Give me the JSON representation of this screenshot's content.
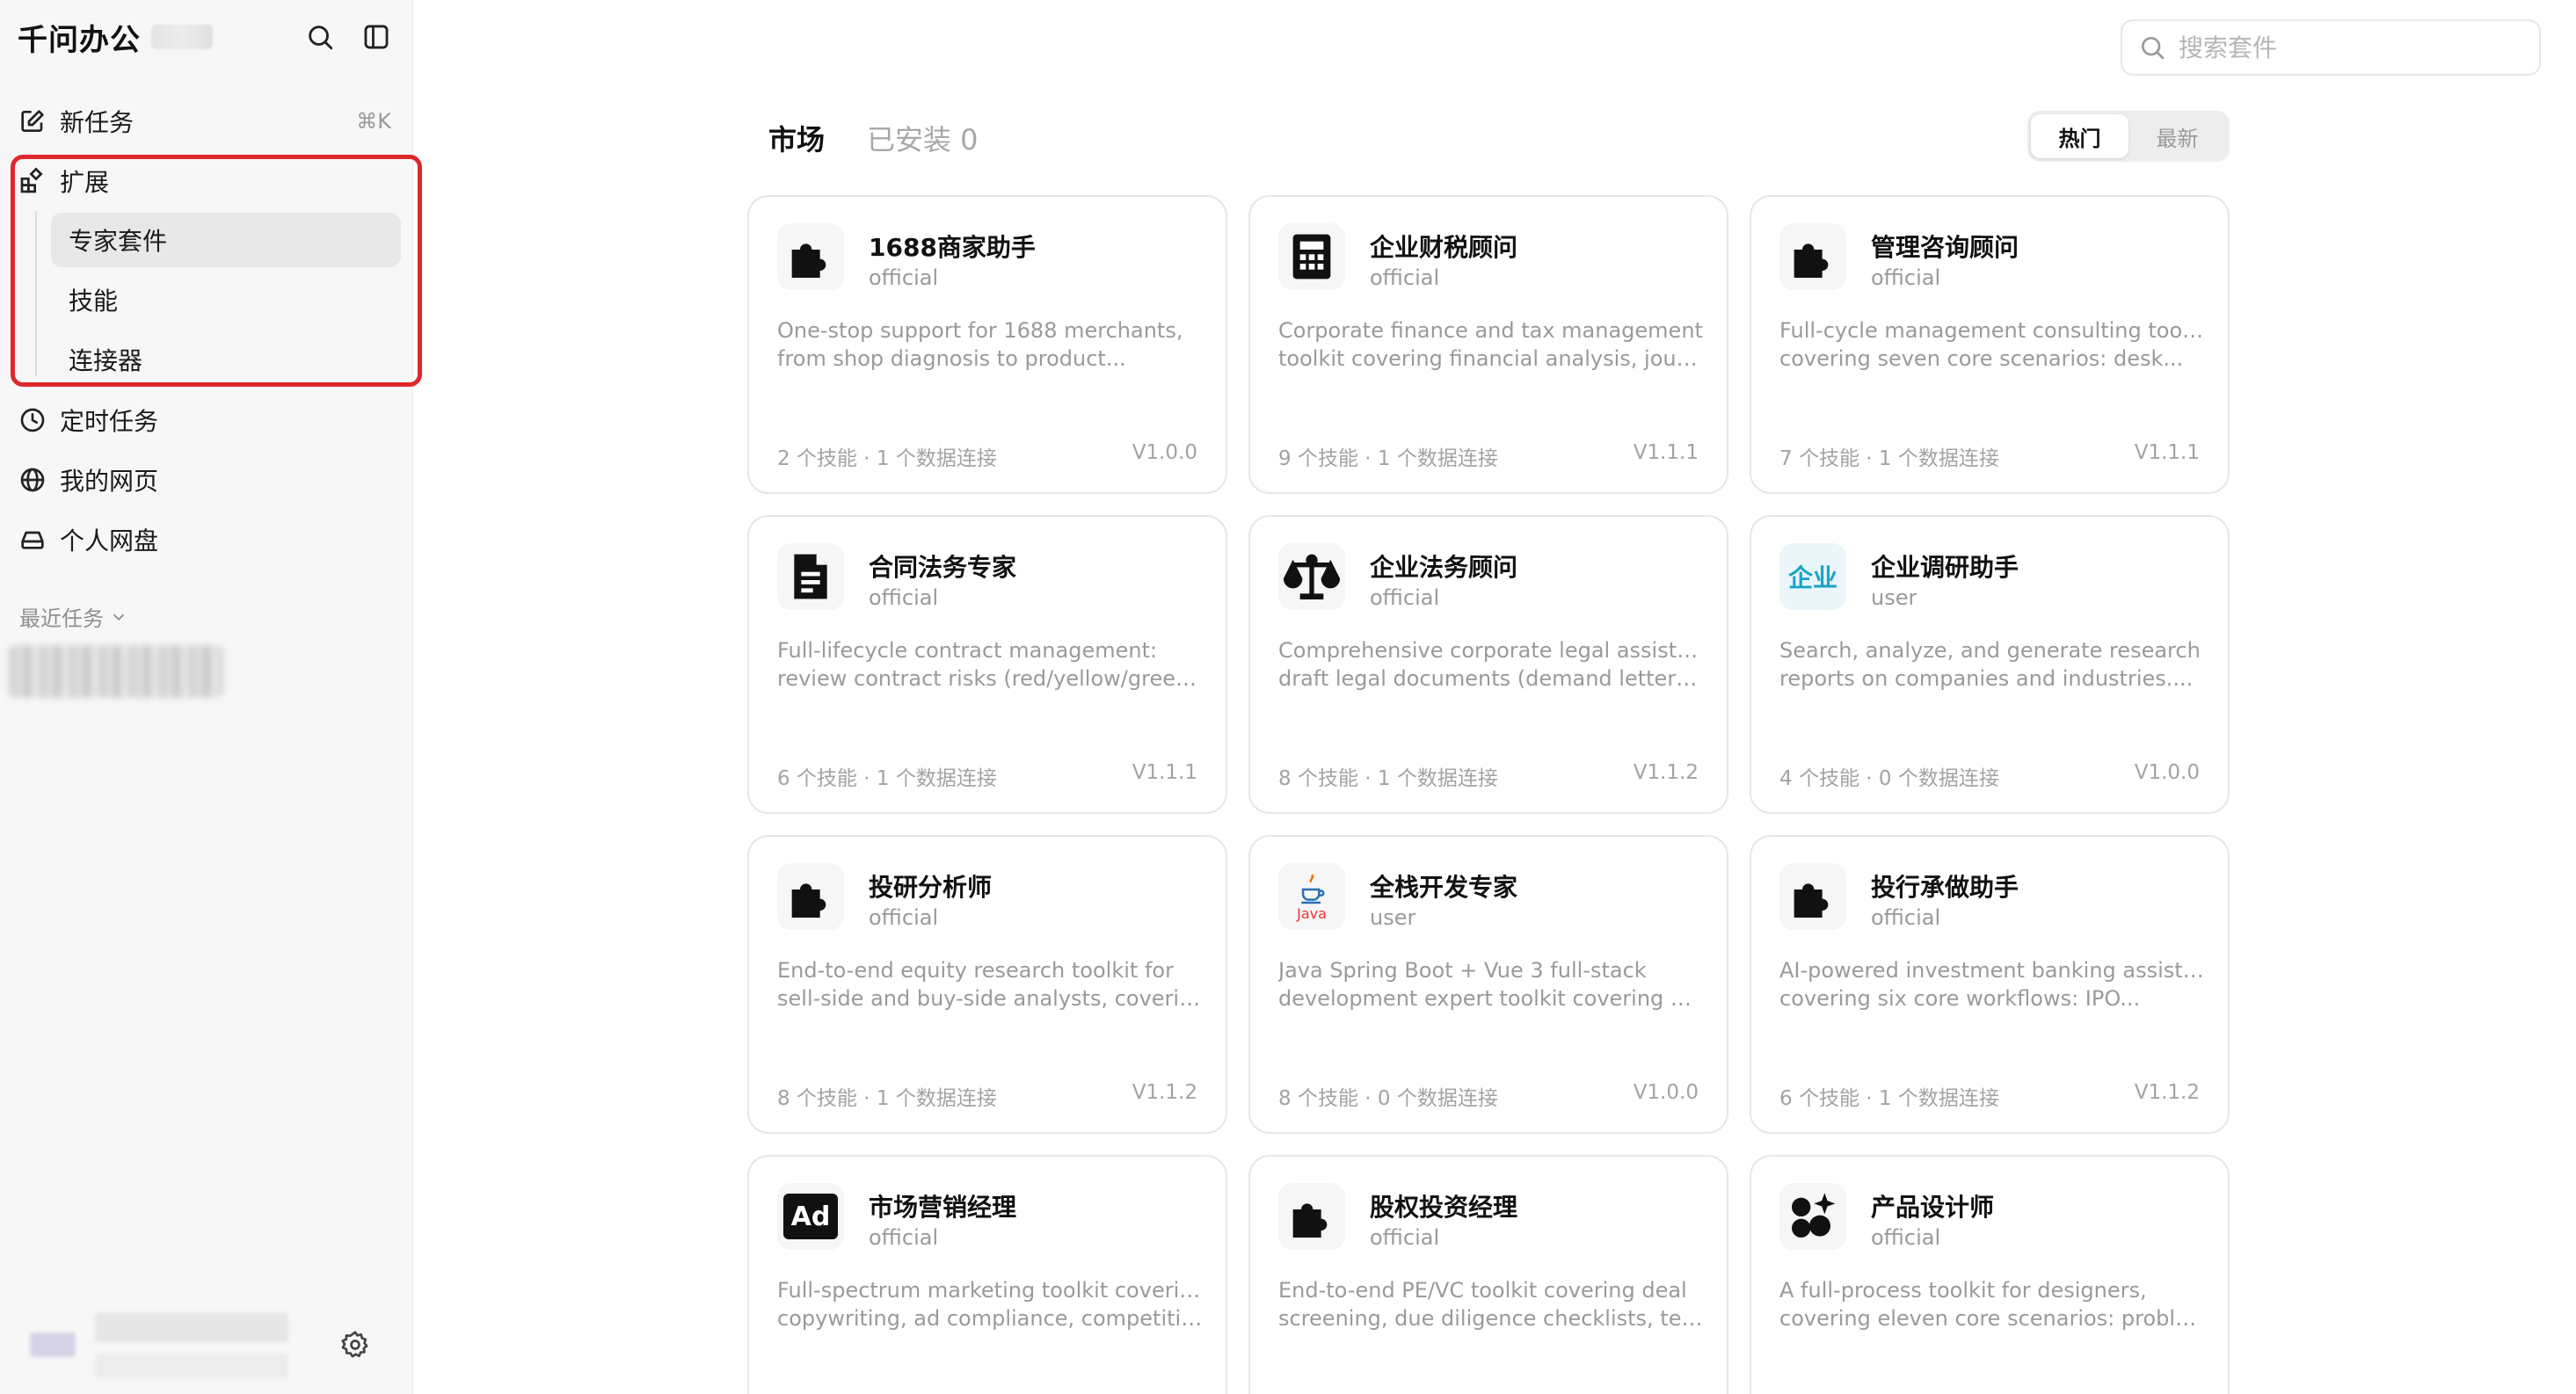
{
  "sidebar": {
    "app_title": "千问办公",
    "new_task": {
      "label": "新任务",
      "shortcut": "⌘K"
    },
    "extensions": {
      "label": "扩展",
      "children": [
        {
          "label": "专家套件",
          "active": true
        },
        {
          "label": "技能",
          "active": false
        },
        {
          "label": "连接器",
          "active": false
        }
      ]
    },
    "items": [
      {
        "label": "定时任务",
        "icon": "clock-icon"
      },
      {
        "label": "我的网页",
        "icon": "globe-icon"
      },
      {
        "label": "个人网盘",
        "icon": "drive-icon"
      }
    ],
    "recent_label": "最近任务"
  },
  "main": {
    "search_placeholder": "搜索套件",
    "tabs": {
      "market": "市场",
      "installed": "已安装 0"
    },
    "sort": {
      "hot": "热门",
      "latest": "最新"
    },
    "cards": [
      {
        "title": "1688商家助手",
        "source": "official",
        "icon": "puzzle-icon",
        "desc1": "One-stop support for 1688 merchants,",
        "desc2": "from shop diagnosis to product...",
        "stats": "2 个技能 · 1 个数据连接",
        "version": "V1.0.0"
      },
      {
        "title": "企业财税顾问",
        "source": "official",
        "icon": "calculator-icon",
        "desc1": "Corporate finance and tax management",
        "desc2": "toolkit covering financial analysis, journa...",
        "stats": "9 个技能 · 1 个数据连接",
        "version": "V1.1.1"
      },
      {
        "title": "管理咨询顾问",
        "source": "official",
        "icon": "puzzle-icon",
        "desc1": "Full-cycle management consulting toolkit",
        "desc2": "covering seven core scenarios: desk...",
        "stats": "7 个技能 · 1 个数据连接",
        "version": "V1.1.1"
      },
      {
        "title": "合同法务专家",
        "source": "official",
        "icon": "document-icon",
        "desc1": "Full-lifecycle contract management:",
        "desc2": "review contract risks (red/yellow/green...",
        "stats": "6 个技能 · 1 个数据连接",
        "version": "V1.1.1"
      },
      {
        "title": "企业法务顾问",
        "source": "official",
        "icon": "scales-icon",
        "desc1": "Comprehensive corporate legal assistant:",
        "desc2": "draft legal documents (demand letters,...",
        "stats": "8 个技能 · 1 个数据连接",
        "version": "V1.1.2"
      },
      {
        "title": "企业调研助手",
        "source": "user",
        "icon": "enterprise-icon",
        "icon_text": "企业",
        "desc1": "Search, analyze, and generate research",
        "desc2": "reports on companies and industries....",
        "stats": "4 个技能 · 0 个数据连接",
        "version": "V1.0.0"
      },
      {
        "title": "投研分析师",
        "source": "official",
        "icon": "puzzle-icon",
        "desc1": "End-to-end equity research toolkit for",
        "desc2": "sell-side and buy-side analysts, coverin...",
        "stats": "8 个技能 · 1 个数据连接",
        "version": "V1.1.2"
      },
      {
        "title": "全栈开发专家",
        "source": "user",
        "icon": "java-icon",
        "icon_text": "Java",
        "desc1": "Java Spring Boot + Vue 3 full-stack",
        "desc2": "development expert toolkit covering API...",
        "stats": "8 个技能 · 0 个数据连接",
        "version": "V1.0.0"
      },
      {
        "title": "投行承做助手",
        "source": "official",
        "icon": "puzzle-icon",
        "desc1": "AI-powered investment banking assistant",
        "desc2": "covering six core workflows: IPO...",
        "stats": "6 个技能 · 1 个数据连接",
        "version": "V1.1.2"
      },
      {
        "title": "市场营销经理",
        "source": "official",
        "icon": "ad-icon",
        "icon_text": "Ad",
        "desc1": "Full-spectrum marketing toolkit covering",
        "desc2": "copywriting, ad compliance, competitive...",
        "stats": "",
        "version": ""
      },
      {
        "title": "股权投资经理",
        "source": "official",
        "icon": "puzzle-icon",
        "desc1": "End-to-end PE/VC toolkit covering deal",
        "desc2": "screening, due diligence checklists, ter...",
        "stats": "",
        "version": ""
      },
      {
        "title": "产品设计师",
        "source": "official",
        "icon": "design-icon",
        "desc1": "A full-process toolkit for designers,",
        "desc2": "covering eleven core scenarios: problem...",
        "stats": "",
        "version": ""
      }
    ]
  }
}
